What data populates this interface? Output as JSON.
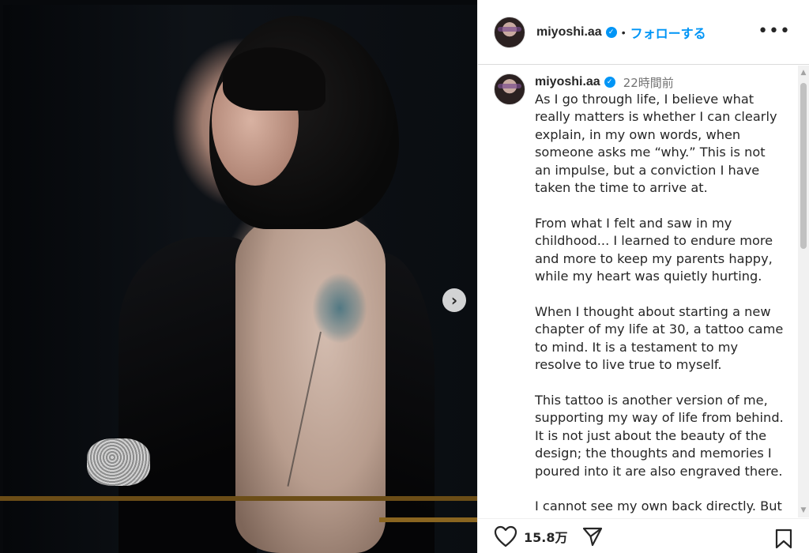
{
  "post": {
    "username": "miyoshi.aa",
    "verified_icon": "verified-badge-icon",
    "separator": "•",
    "follow_label": "フォローする",
    "more_label": "•••",
    "next_icon": "chevron-right-icon"
  },
  "caption": {
    "username": "miyoshi.aa",
    "time": "22時間前",
    "text": "As I go through life, I believe what really matters is whether I can clearly explain, in my own words, when someone asks me “why.”  This is not an impulse, but a conviction I have taken the time to arrive at.\n\nFrom what I felt and saw in my childhood... I learned to endure more and more to keep my parents happy, while my heart was quietly hurting.\n\nWhen I thought about starting a new chapter of my life at 30, a tattoo came to mind. It is a testament to my resolve to live true to myself.\n\nThis tattoo is another version of me, supporting my way of life from behind. It is not just about the beauty of the design; the thoughts and memories I poured into it are also engraved there.\n\nI cannot see my own back directly. But I"
  },
  "actions": {
    "likes": "15.8万",
    "like_icon": "heart-icon",
    "share_icon": "send-icon",
    "save_icon": "bookmark-icon"
  },
  "colors": {
    "accent": "#0095f6",
    "text": "#262626",
    "muted": "#737373"
  }
}
